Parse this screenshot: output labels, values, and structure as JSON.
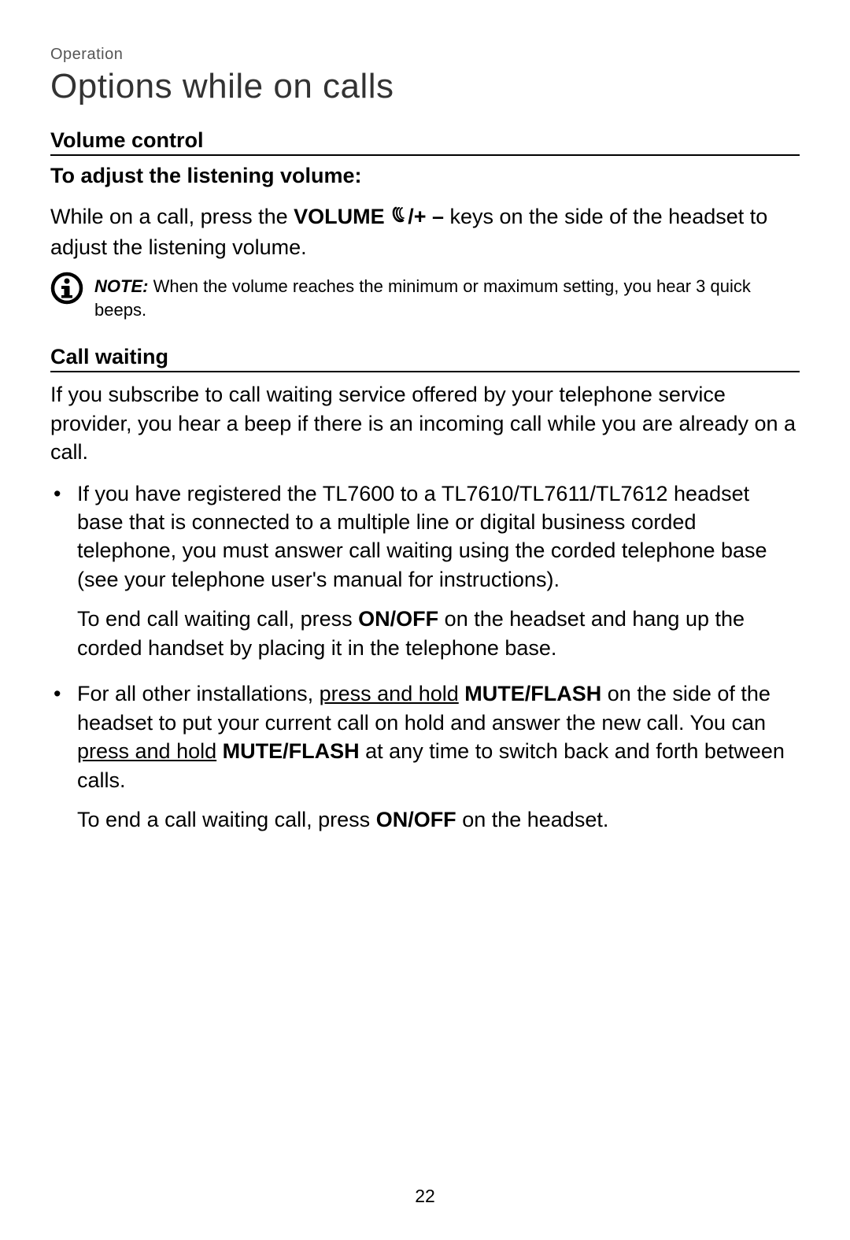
{
  "breadcrumb": "Operation",
  "page_title": "Options while on calls",
  "volume": {
    "heading": "Volume control",
    "subheading": "To adjust the listening volume:",
    "body_pre": "While on a call, press the ",
    "body_bold": "VOLUME",
    "body_symbols": "/+ –",
    "body_post": " keys on the side of the headset to adjust the listening volume.",
    "note_label": "NOTE:",
    "note_text": " When the volume reaches the minimum or maximum setting, you hear 3 quick beeps."
  },
  "callwaiting": {
    "heading": "Call waiting",
    "intro": "If you subscribe to call waiting service offered by your telephone service provider, you hear a beep if there is an incoming call while you are already on a call.",
    "b1_p1": "If you have registered the TL7600 to a TL7610/TL7611/TL7612 headset base that is connected to a multiple line or digital business corded telephone, you must answer call waiting using the corded telephone base (see your telephone user's manual for instructions).",
    "b1_p2_pre": "To end call waiting call, press ",
    "b1_p2_on": "ON",
    "b1_p2_off": "/OFF",
    "b1_p2_post": " on the headset and hang up the corded handset by placing it in the telephone base.",
    "b2_p1_a": "For all other installations, ",
    "b2_p1_pressANDhold1": "press and hold",
    "b2_p1_space": " ",
    "b2_p1_mute": "MUTE",
    "b2_p1_flash": "/FLASH",
    "b2_p1_b": " on the side of the headset to put your current call on hold and answer the new call. You can ",
    "b2_p1_pressANDhold2": "press and hold",
    "b2_p1_c": " at any time to switch back and forth between calls.",
    "b2_p2_pre": "To end a call waiting call, press ",
    "b2_p2_on": "ON",
    "b2_p2_off": "/OFF",
    "b2_p2_post": " on the headset."
  },
  "page_number": "22"
}
